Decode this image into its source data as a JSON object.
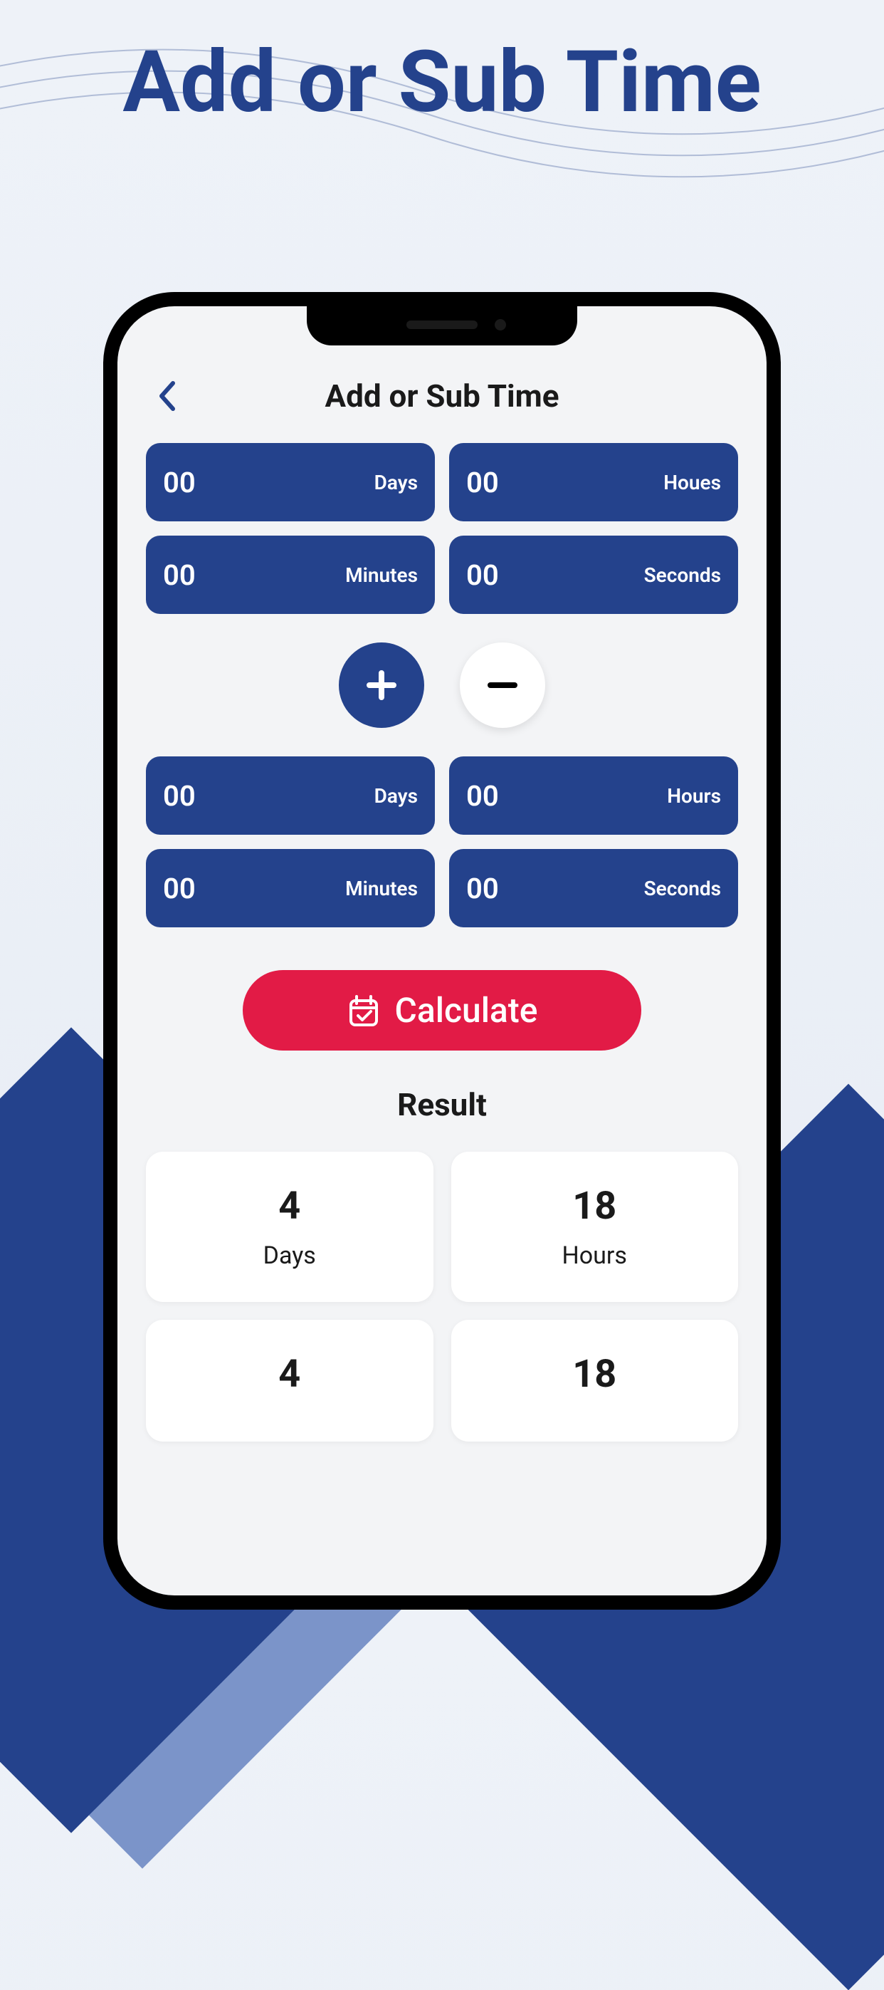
{
  "marketing": {
    "title": "Add or Sub Time"
  },
  "header": {
    "title": "Add or Sub Time"
  },
  "input1": {
    "days": {
      "value": "00",
      "label": "Days"
    },
    "hours": {
      "value": "00",
      "label": "Houes"
    },
    "minutes": {
      "value": "00",
      "label": "Minutes"
    },
    "seconds": {
      "value": "00",
      "label": "Seconds"
    }
  },
  "input2": {
    "days": {
      "value": "00",
      "label": "Days"
    },
    "hours": {
      "value": "00",
      "label": "Hours"
    },
    "minutes": {
      "value": "00",
      "label": "Minutes"
    },
    "seconds": {
      "value": "00",
      "label": "Seconds"
    }
  },
  "actions": {
    "calculate": "Calculate"
  },
  "result": {
    "title": "Result",
    "days": {
      "value": "4",
      "label": "Days"
    },
    "hours": {
      "value": "18",
      "label": "Hours"
    },
    "minutes": {
      "value": "4"
    },
    "seconds": {
      "value": "18"
    }
  },
  "colors": {
    "primary": "#24428c",
    "accent": "#e21b46",
    "background": "#f3f4f6"
  }
}
